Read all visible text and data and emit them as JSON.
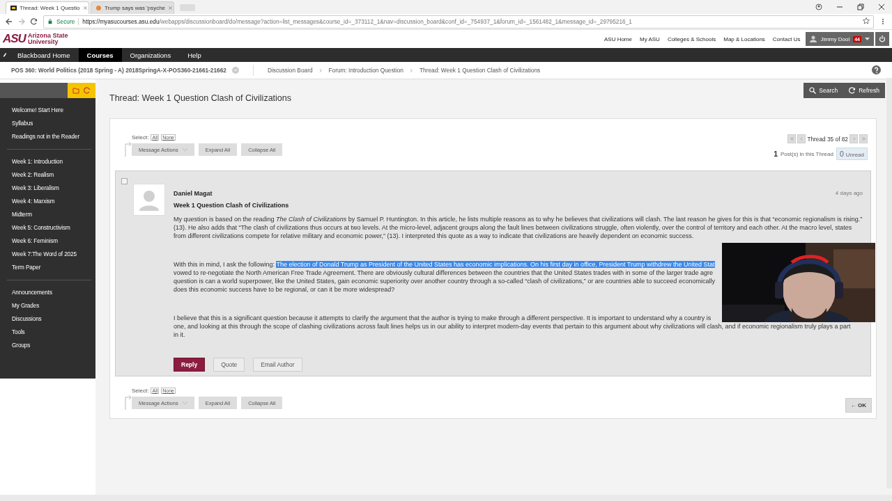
{
  "browser": {
    "tabs": [
      {
        "title": "Thread: Week 1 Questio",
        "selected": true
      },
      {
        "title": "Trump says was 'psyche",
        "selected": false
      }
    ],
    "secure_label": "Secure",
    "url_host": "https://myasucourses.asu.edu",
    "url_path": "/webapps/discussionboard/do/message?action=list_messages&course_id=_373112_1&nav=discussion_board&conf_id=_754937_1&forum_id=_1561482_1&message_id=_29795216_1"
  },
  "logo": {
    "mark": "ASU",
    "line1": "Arizona State",
    "line2": "University"
  },
  "top_links": [
    "ASU Home",
    "My ASU",
    "Colleges & Schools",
    "Map & Locations",
    "Contact Us"
  ],
  "user": {
    "name": "Jimmy Dool",
    "badge": "44"
  },
  "nav": [
    {
      "label": "Blackboard Home",
      "selected": false
    },
    {
      "label": "Courses",
      "selected": true
    },
    {
      "label": "Organizations",
      "selected": false
    },
    {
      "label": "Help",
      "selected": false
    }
  ],
  "course": "POS 360: World Politics (2018 Spring - A) 2018SpringA-X-POS360-21661-21662",
  "breadcrumbs": [
    "Discussion Board",
    "Forum: Introduction Question",
    "Thread: Week 1 Question Clash of Civilizations"
  ],
  "sidebar": [
    [
      "Welcome! Start Here",
      "Syllabus",
      "Readings not in the Reader"
    ],
    [
      "Week 1: Introduction",
      "Week 2: Realism",
      "Week 3: Liberalism",
      "Week 4: Marxism",
      "Midterm",
      "Week 5: Constructivism",
      "Week 6: Feminism",
      "Week 7:The Word of 2025",
      "Term Paper"
    ],
    [
      "Announcements",
      "My Grades",
      "Discussions",
      "Tools",
      "Groups"
    ]
  ],
  "page_title": "Thread: Week 1 Question Clash of Civilizations",
  "page_tools": [
    "Search",
    "Refresh"
  ],
  "controls": [
    {
      "select": "Select:",
      "all": "All",
      "none": "None",
      "buttons": [
        "Message Actions",
        "Expand All",
        "Collapse All"
      ]
    },
    {
      "select": "Select:",
      "all": "All",
      "none": "None",
      "buttons": [
        "Message Actions",
        "Expand All",
        "Collapse All"
      ]
    }
  ],
  "pager": "Thread 35 of 82",
  "posts_count": "1",
  "posts_label": "Post(s) in this Thread",
  "unread_count": "0",
  "unread_label": "Unread",
  "post": {
    "checked": false,
    "author": "Daniel Magat",
    "subject": "Week 1 Question Clash of Civilizations",
    "time": "4 days ago",
    "paragraphs": [
      {
        "lines": [
          "My question is based on the reading *The Clash of Civilizations* by Samuel P. Huntington. In this article, he lists multiple reasons as to why he believes that civilizations will clash. The last reason he gives for this is that “economic regionalism is rising.”",
          "(13). He also adds that “The clash of civilizations thus occurs at two levels. At the micro-level, adjacent groups along the fault lines between civilizations struggle, often violently, over the control of territory and each other. At the macro level, states",
          "from different civilizations compete for relative military and economic power,” (13). I interpreted this quote as a way to indicate that civilizations are heavily dependent on economic success."
        ]
      },
      {
        "lead": "With this in mind, I ask the following:",
        "selected_text": "The election of Donald Trump as President of the United States has economic implications. On his first day in office, President Trump withdrew the United Stat",
        "lines": [
          "vowed to re-negotiate the North American Free Trade Agreement. There are obviously cultural differences between the countries that the United States trades with in some of the larger trade agre",
          "question is can a world superpower, like the United States, gain economic superiority over another country through a so-called “clash of civilizations,” or are countries able to succeed economically",
          "does this economic success have to be regional, or can it be more widespread?"
        ]
      },
      {
        "lines": [
          "I believe that this is a significant question because it attempts to clarify the argument that the author is trying to make through a different perspective. It is important to understand why a country is",
          "one, and looking at this through the scope of clashing civilizations across fault lines helps us in our ability to interpret modern-day events that pertain to this argument about why civilizations will clash, and if economic regionalism truly plays a part",
          "in it."
        ]
      }
    ],
    "actions": [
      {
        "label": "Reply",
        "kind": "primary"
      },
      {
        "label": "Quote",
        "kind": "plain"
      },
      {
        "label": "Email Author",
        "kind": "plain"
      }
    ]
  },
  "webcam": {
    "kind": "picture"
  },
  "ok_button": "← OK"
}
